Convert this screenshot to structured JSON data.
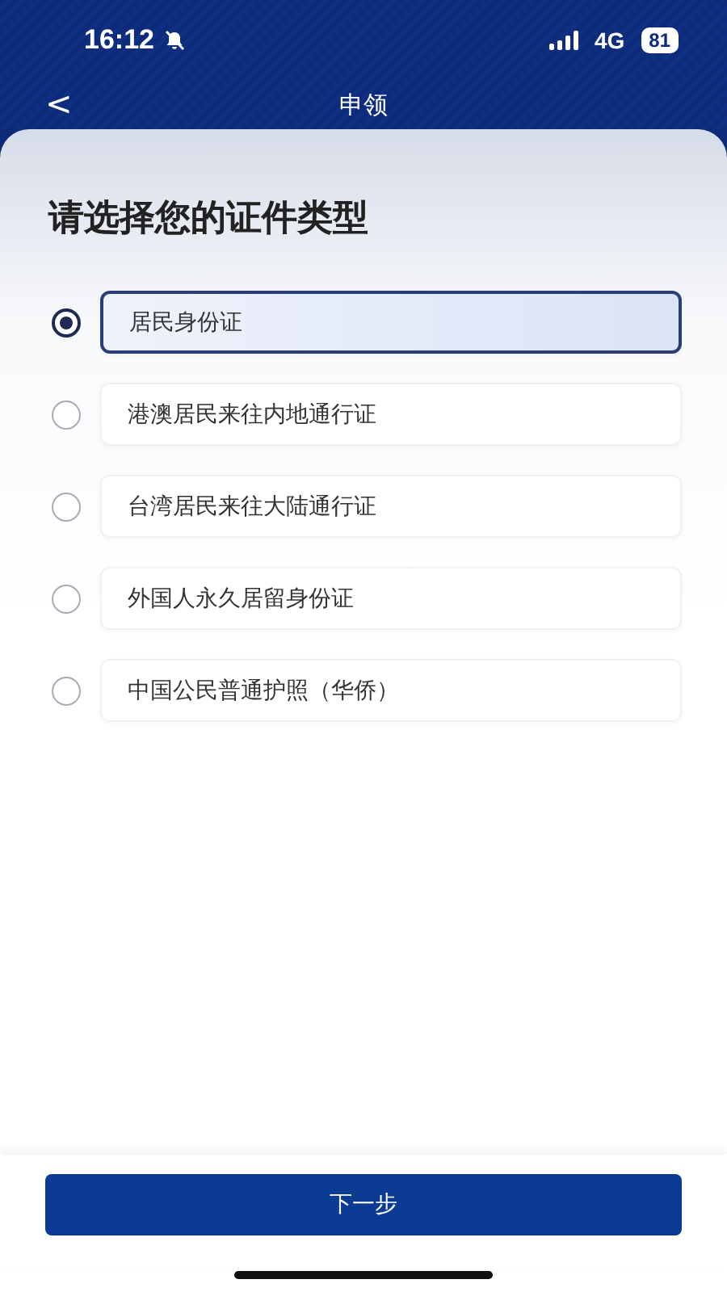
{
  "status_bar": {
    "time": "16:12",
    "network": "4G",
    "battery": "81"
  },
  "nav": {
    "back": "<",
    "title": "申领"
  },
  "heading": "请选择您的证件类型",
  "options": [
    {
      "label": "居民身份证",
      "selected": true
    },
    {
      "label": "港澳居民来往内地通行证",
      "selected": false
    },
    {
      "label": "台湾居民来往大陆通行证",
      "selected": false
    },
    {
      "label": "外国人永久居留身份证",
      "selected": false
    },
    {
      "label": "中国公民普通护照（华侨）",
      "selected": false
    }
  ],
  "next_button": "下一步"
}
